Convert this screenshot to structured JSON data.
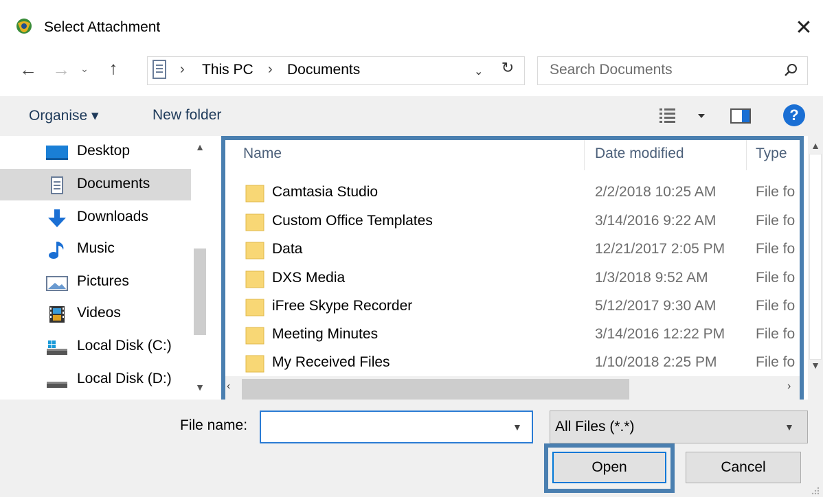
{
  "window": {
    "title": "Select Attachment",
    "close_glyph": "✕"
  },
  "address": {
    "back_glyph": "←",
    "forward_glyph": "→",
    "recent_glyph": "⌄",
    "up_glyph": "↑",
    "crumbs": [
      "This PC",
      "Documents"
    ],
    "crumb_sep": "›",
    "dropdown_glyph": "⌄",
    "refresh_glyph": "↻"
  },
  "search": {
    "placeholder": "Search Documents"
  },
  "toolbar": {
    "organise_label": "Organise ▾",
    "new_folder_label": "New folder",
    "help_label": "?"
  },
  "nav_pane": {
    "items": [
      {
        "label": "Desktop",
        "icon": "desktop-icon",
        "selected": false
      },
      {
        "label": "Documents",
        "icon": "documents-icon",
        "selected": true
      },
      {
        "label": "Downloads",
        "icon": "downloads-icon",
        "selected": false
      },
      {
        "label": "Music",
        "icon": "music-icon",
        "selected": false
      },
      {
        "label": "Pictures",
        "icon": "pictures-icon",
        "selected": false
      },
      {
        "label": "Videos",
        "icon": "videos-icon",
        "selected": false
      },
      {
        "label": "Local Disk (C:)",
        "icon": "local-disk-icon",
        "selected": false
      },
      {
        "label": "Local Disk (D:)",
        "icon": "local-disk-icon",
        "selected": false
      }
    ]
  },
  "file_list": {
    "columns": {
      "name": "Name",
      "date": "Date modified",
      "type": "Type"
    },
    "rows": [
      {
        "name": "Camtasia Studio",
        "date": "2/2/2018 10:25 AM",
        "type": "File folder"
      },
      {
        "name": "Custom Office Templates",
        "date": "3/14/2016 9:22 AM",
        "type": "File folder"
      },
      {
        "name": "Data",
        "date": "12/21/2017 2:05 PM",
        "type": "File folder"
      },
      {
        "name": "DXS Media",
        "date": "1/3/2018 9:52 AM",
        "type": "File folder"
      },
      {
        "name": "iFree Skype Recorder",
        "date": "5/12/2017 9:30 AM",
        "type": "File folder"
      },
      {
        "name": "Meeting Minutes",
        "date": "3/14/2016 12:22 PM",
        "type": "File folder"
      },
      {
        "name": "My Received Files",
        "date": "1/10/2018 2:25 PM",
        "type": "File folder"
      }
    ]
  },
  "bottom": {
    "file_name_label": "File name:",
    "file_name_value": "",
    "filter_label": "All Files (*.*)",
    "open_label": "Open",
    "cancel_label": "Cancel"
  },
  "colors": {
    "highlight_outline": "#4a7fb0",
    "accent": "#0078d7",
    "help_blue": "#1a6fd4",
    "folder_yellow": "#f8d775"
  }
}
